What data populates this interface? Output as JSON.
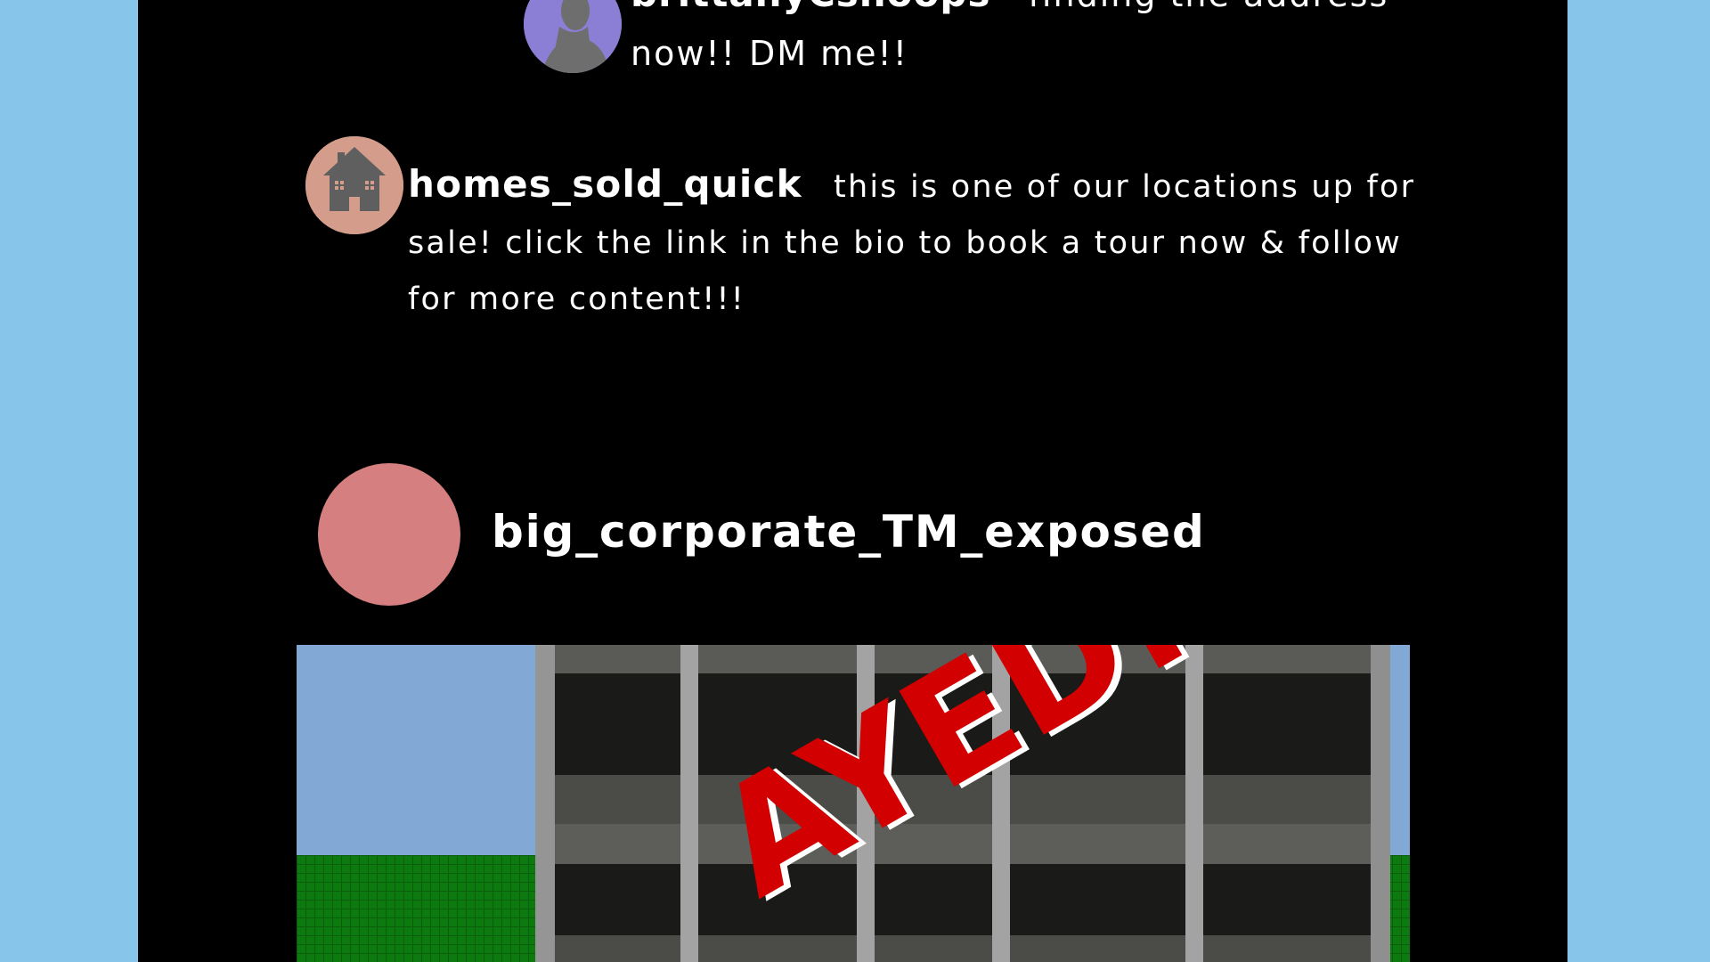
{
  "comments": [
    {
      "username": "brittanyCsnoops",
      "text": "finding the address now!! DM me!!",
      "avatar_icon": "person-silhouette-icon",
      "avatar_color": "#8a7fd4"
    },
    {
      "username": "homes_sold_quick",
      "text": "this is one of our locations up for sale! click the link in the bio to book a tour now & follow for more content!!!",
      "avatar_icon": "house-icon",
      "avatar_color": "#d49d8b"
    }
  ],
  "post": {
    "username": "big_corporate_TM_exposed",
    "avatar_color": "#d67f80",
    "image_stamp_text": "AYED!",
    "colors": {
      "sky": "#82a9d6",
      "grass": "#0d7a10",
      "stamp": "#d20000"
    }
  },
  "page": {
    "background": "#87c6ea",
    "feed_background": "#000000"
  }
}
